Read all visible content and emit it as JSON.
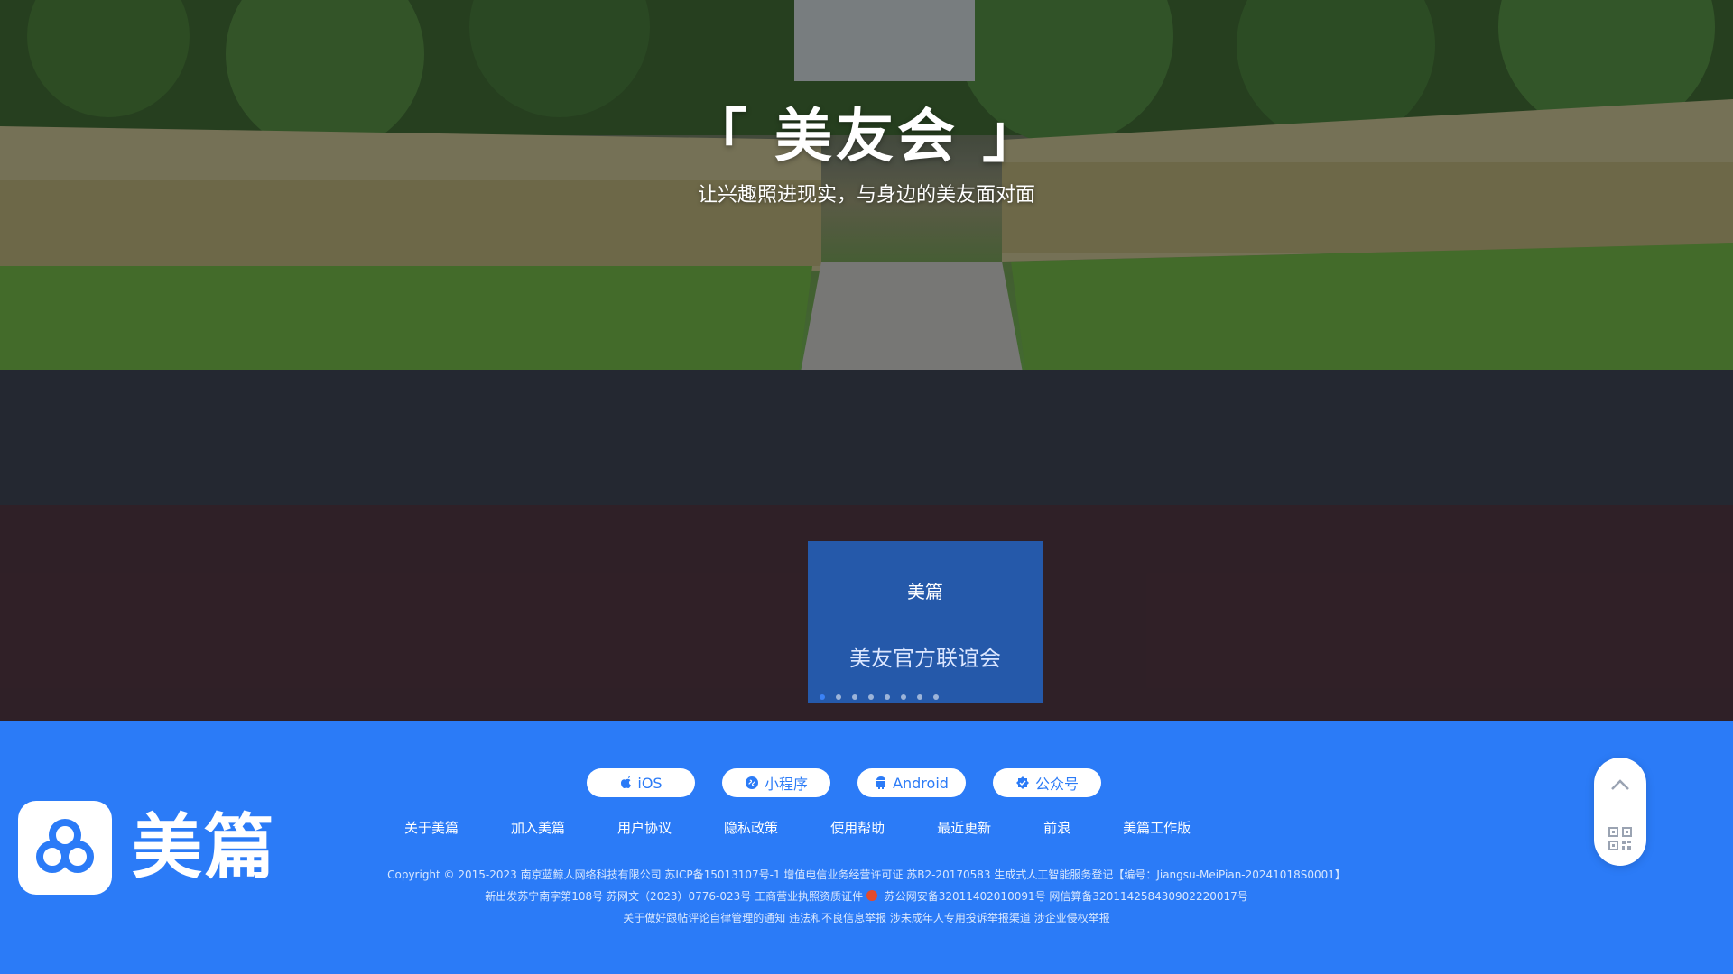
{
  "hero": {
    "title": "「 美友会 」",
    "subtitle": "让兴趣照进现实，与身边的美友面对面",
    "banner_brand": "美篇",
    "banner_text": "美友官方联谊会",
    "slides_total": 8,
    "active_slide": 1
  },
  "footer": {
    "logo_text": "美篇",
    "platform_buttons": [
      {
        "label": "iOS",
        "icon": "apple-icon"
      },
      {
        "label": "小程序",
        "icon": "miniprogram-icon"
      },
      {
        "label": "Android",
        "icon": "android-icon"
      },
      {
        "label": "公众号",
        "icon": "official-account-icon"
      }
    ],
    "links": [
      "关于美篇",
      "加入美篇",
      "用户协议",
      "隐私政策",
      "使用帮助",
      "最近更新",
      "前浪",
      "美篇工作版"
    ],
    "legal": {
      "line1": "Copyright © 2015-2023 南京蓝鲸人网络科技有限公司 苏ICP备15013107号-1 增值电信业务经营许可证 苏B2-20170583 生成式人工智能服务登记【编号：Jiangsu-MeiPian-20241018S0001】",
      "line2a": "新出发苏宁南字第108号 苏网文（2023）0776-023号 工商营业执照资质证件 ",
      "line2b": "苏公网安备32011402010091号 网信算备320114258430902220017号",
      "line3": "关于做好跟帖评论自律管理的通知 违法和不良信息举报 涉未成年人专用投诉举报渠道 涉企业侵权举报"
    },
    "side_widget": {
      "icons": [
        "back-to-top-icon",
        "qr-code-icon"
      ]
    }
  },
  "colors": {
    "brand": "#2b7bf7",
    "white": "#ffffff"
  }
}
